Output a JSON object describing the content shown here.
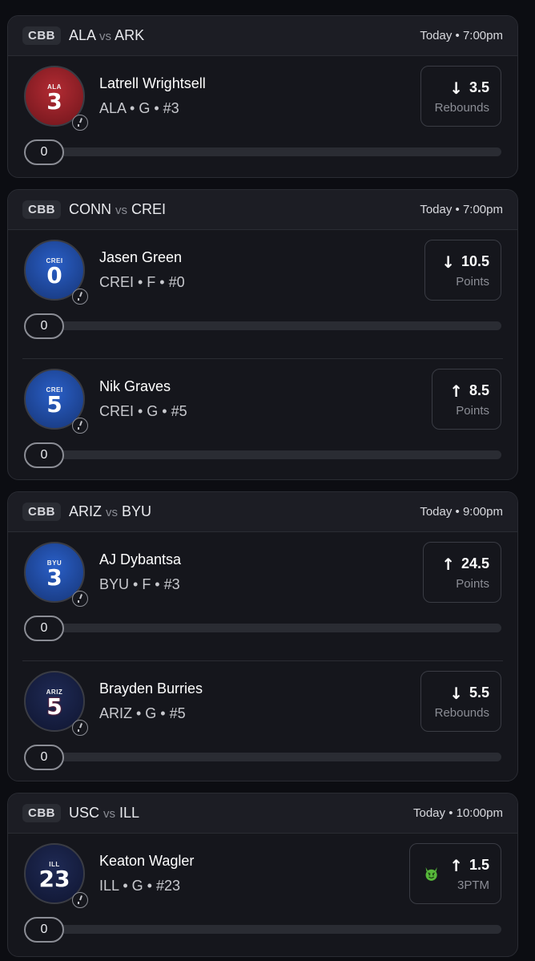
{
  "games": [
    {
      "league": "CBB",
      "team1": "ALA",
      "vs": "vs",
      "team2": "ARK",
      "time": "Today • 7:00pm",
      "players": [
        {
          "name": "Latrell Wrightsell",
          "meta": "ALA • G • #3",
          "jersey_team": "ALA",
          "jersey_number": "3",
          "jersey_color": "#9e2128",
          "direction": "down",
          "arrow": "↓",
          "line": "3.5",
          "stat": "Rebounds",
          "progress": "0"
        }
      ]
    },
    {
      "league": "CBB",
      "team1": "CONN",
      "vs": "vs",
      "team2": "CREI",
      "time": "Today • 7:00pm",
      "players": [
        {
          "name": "Jasen Green",
          "meta": "CREI • F • #0",
          "jersey_team": "CREI",
          "jersey_number": "0",
          "jersey_color": "#2450b0",
          "direction": "down",
          "arrow": "↓",
          "line": "10.5",
          "stat": "Points",
          "progress": "0"
        },
        {
          "name": "Nik Graves",
          "meta": "CREI • G • #5",
          "jersey_team": "CREI",
          "jersey_number": "5",
          "jersey_color": "#2450b0",
          "direction": "up",
          "arrow": "↑",
          "line": "8.5",
          "stat": "Points",
          "progress": "0"
        }
      ]
    },
    {
      "league": "CBB",
      "team1": "ARIZ",
      "vs": "vs",
      "team2": "BYU",
      "time": "Today • 9:00pm",
      "players": [
        {
          "name": "AJ Dybantsa",
          "meta": "BYU • F • #3",
          "jersey_team": "BYU",
          "jersey_number": "3",
          "jersey_color": "#2450b0",
          "direction": "up",
          "arrow": "↑",
          "line": "24.5",
          "stat": "Points",
          "progress": "0"
        },
        {
          "name": "Brayden Burries",
          "meta": "ARIZ • G • #5",
          "jersey_team": "ARIZ",
          "jersey_number": "5",
          "jersey_color": "#1a2450",
          "direction": "down",
          "arrow": "↓",
          "line": "5.5",
          "stat": "Rebounds",
          "progress": "0"
        }
      ]
    },
    {
      "league": "CBB",
      "team1": "USC",
      "vs": "vs",
      "team2": "ILL",
      "time": "Today • 10:00pm",
      "players": [
        {
          "name": "Keaton Wagler",
          "meta": "ILL • G • #23",
          "jersey_team": "ILL",
          "jersey_number": "23",
          "jersey_color": "#1a2450",
          "direction": "up",
          "arrow": "↑",
          "line": "1.5",
          "stat": "3PTM",
          "progress": "0",
          "badge_icon": "devil-emoji-icon"
        }
      ]
    }
  ]
}
